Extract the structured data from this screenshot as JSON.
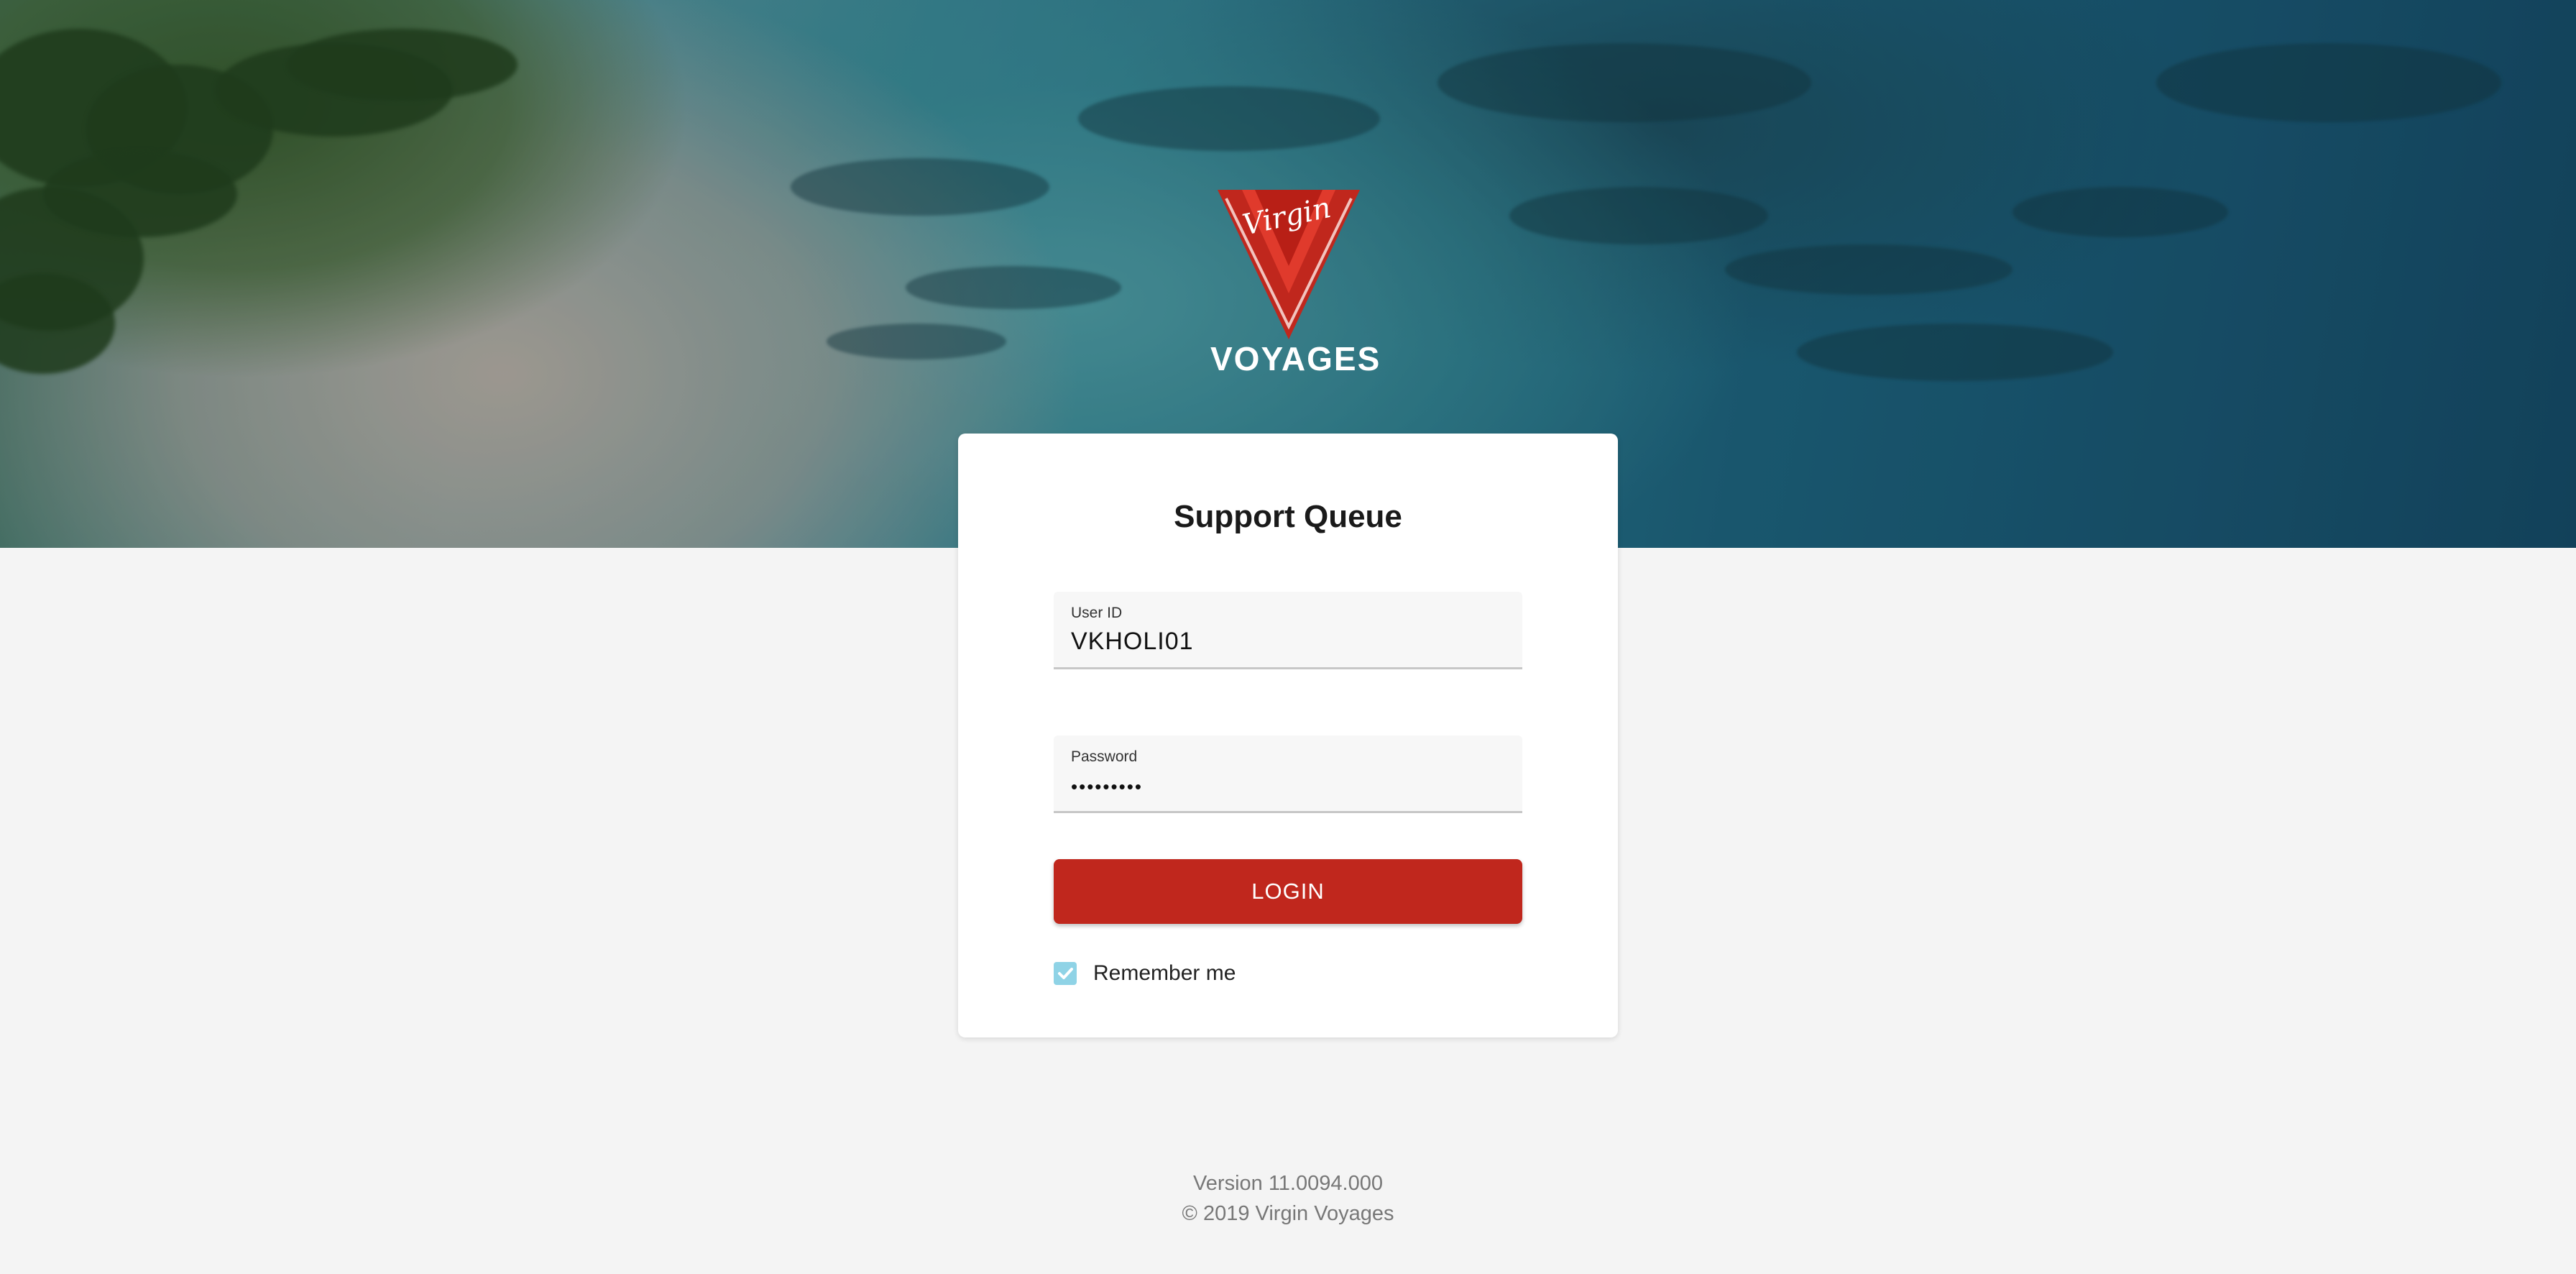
{
  "brand": {
    "logo_script": "Virgin",
    "logo_word": "VOYAGES",
    "primary_color": "#c0271d",
    "accent_color": "#8fd3e6"
  },
  "login": {
    "title": "Support Queue",
    "user_id": {
      "label": "User ID",
      "value": "VKHOLI01"
    },
    "password": {
      "label": "Password",
      "masked_value": "•••••••••"
    },
    "submit_label": "LOGIN",
    "remember": {
      "label": "Remember me",
      "checked": true
    }
  },
  "footer": {
    "version": "Version 11.0094.000",
    "copyright": "© 2019 Virgin Voyages"
  }
}
